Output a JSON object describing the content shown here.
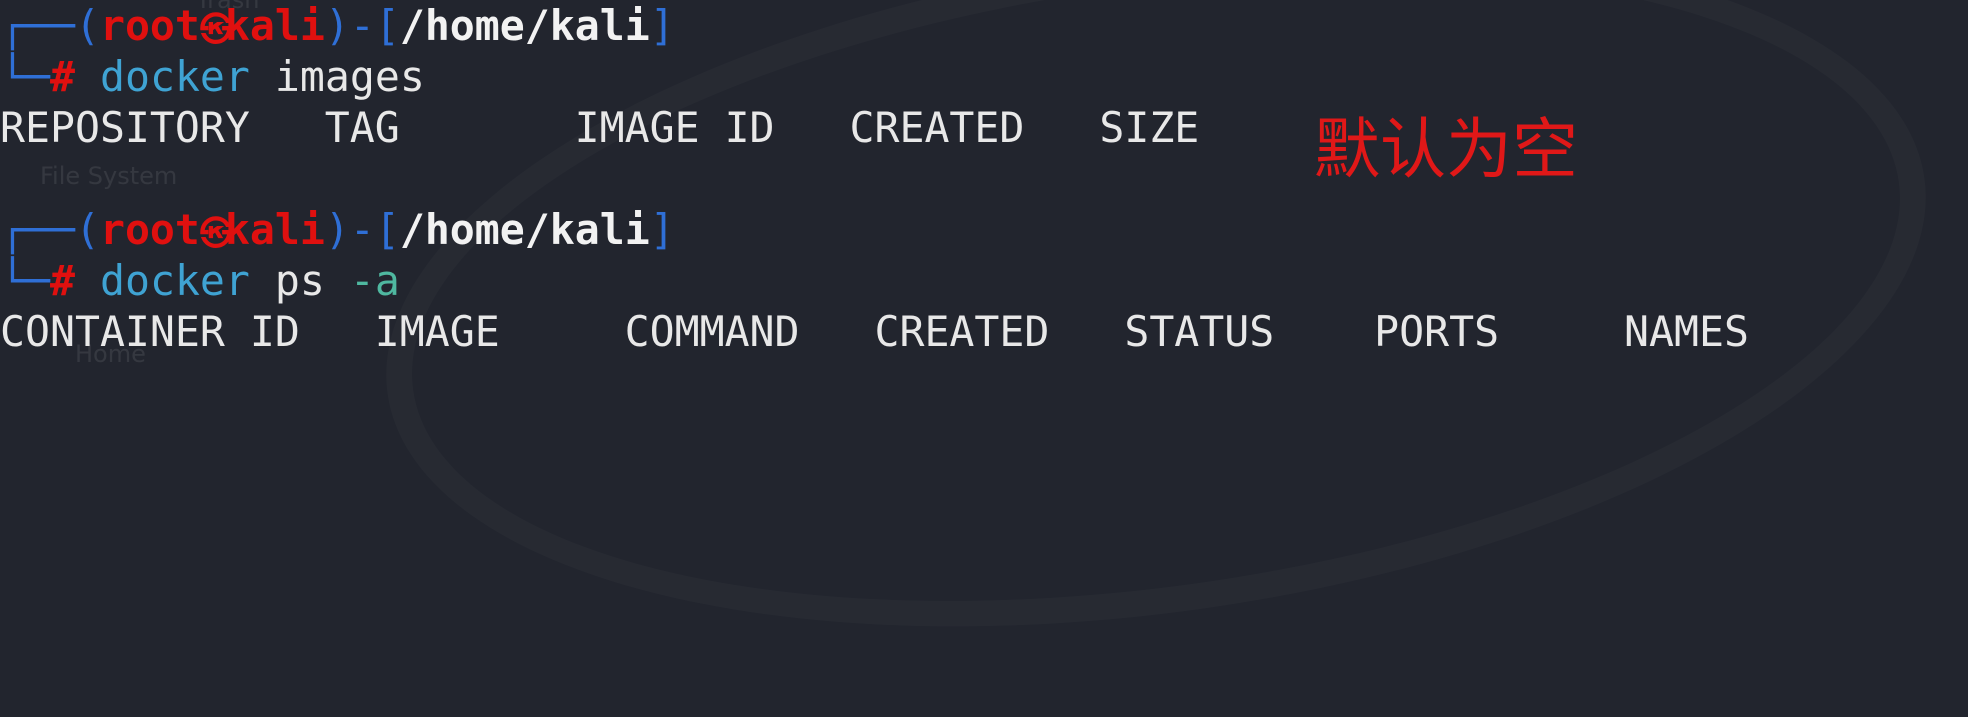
{
  "desktop": {
    "icons": [
      "Trash",
      "File System",
      "Home"
    ]
  },
  "terminal": {
    "prompt": {
      "user": "root",
      "at_symbol": "㉿",
      "host": "kali",
      "cwd": "/home/kali",
      "symbol": "#"
    },
    "commands": [
      {
        "program": "docker",
        "args": "images",
        "flag": "",
        "output": "REPOSITORY   TAG       IMAGE ID   CREATED   SIZE"
      },
      {
        "program": "docker",
        "args": "ps",
        "flag": "-a",
        "output": "CONTAINER ID   IMAGE     COMMAND   CREATED   STATUS    PORTS     NAMES"
      }
    ]
  },
  "annotation": {
    "text": "默认为空",
    "color": "#e01818"
  },
  "colors": {
    "background": "#22252e",
    "prompt_box": "#2f6fd6",
    "prompt_user": "#e0100f",
    "command": "#3fa3d3"
  }
}
